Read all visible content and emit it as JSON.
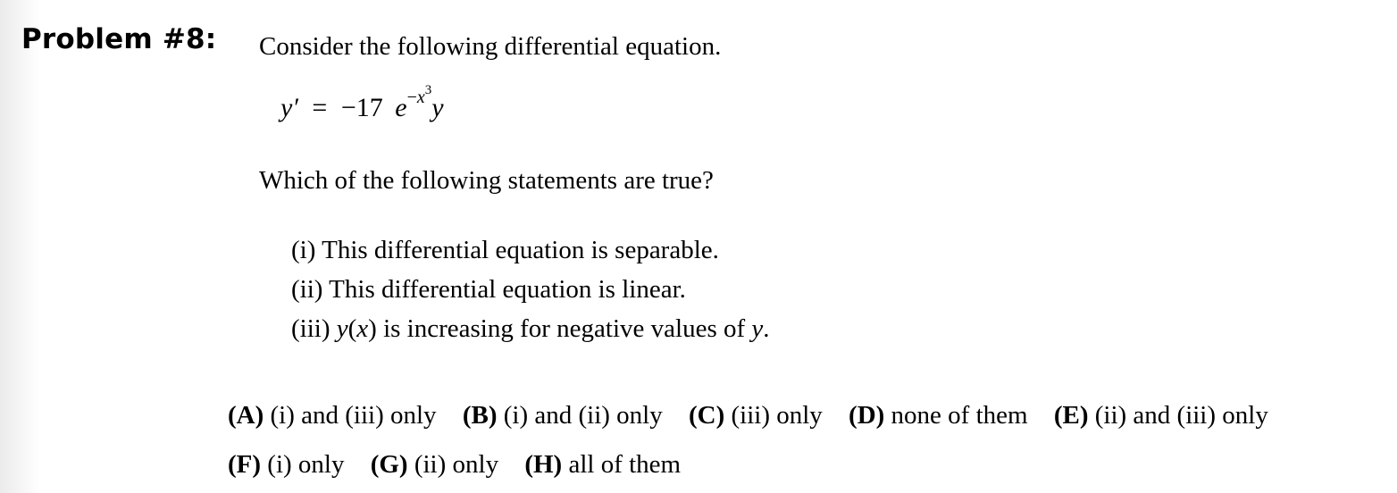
{
  "problem": {
    "title": "Problem #8:",
    "intro": "Consider the following differential equation.",
    "equation": {
      "lhs": "y′",
      "equals": "=",
      "coefficient": "−17",
      "base": "e",
      "exponent_sign": "−",
      "exponent_var": "x",
      "exponent_power": "3",
      "trailing_var": "y"
    },
    "question": "Which of the following statements are true?",
    "statements": [
      {
        "label": "(i)",
        "text": "This differential equation is separable."
      },
      {
        "label": "(ii)",
        "text": "This differential equation is linear."
      },
      {
        "label": "(iii)",
        "pre_func": "y",
        "func_arg_open": "(",
        "func_arg": "x",
        "func_arg_close": ")",
        "text": "is increasing for negative values of",
        "var": "y",
        "end": "."
      }
    ],
    "choices": [
      {
        "letter": "(A)",
        "text": "(i) and (iii) only"
      },
      {
        "letter": "(B)",
        "text": "(i) and (ii) only"
      },
      {
        "letter": "(C)",
        "text": "(iii) only"
      },
      {
        "letter": "(D)",
        "text": "none of them"
      },
      {
        "letter": "(E)",
        "text": "(ii) and (iii) only"
      },
      {
        "letter": "(F)",
        "text": "(i) only"
      },
      {
        "letter": "(G)",
        "text": "(ii) only"
      },
      {
        "letter": "(H)",
        "text": "all of them"
      }
    ]
  }
}
